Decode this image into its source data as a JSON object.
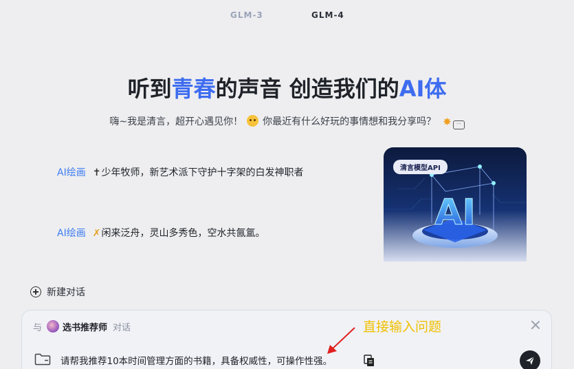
{
  "model_tabs": [
    {
      "label": "GLM-3",
      "active": false
    },
    {
      "label": "GLM-4",
      "active": true
    }
  ],
  "hero": {
    "title_part1": "听到",
    "title_accent1": "青春",
    "title_part2": "的声音 创造我们的",
    "title_accent2": "AI体",
    "subtitle_part1": "嗨~我是清言，超开心遇见你！",
    "subtitle_part2": "你最近有什么好玩的事情想和我分享吗？"
  },
  "suggestions": [
    {
      "tag": "AI绘画",
      "icon": "✝",
      "text": "少年牧师，新艺术派下守护十字架的白发神职者"
    },
    {
      "tag": "AI绘画",
      "icon": "✗",
      "text": "闲来泛舟，灵山多秀色，空水共氤氲。"
    }
  ],
  "ai_card": {
    "badge": "清言模型API",
    "big_text": "AI"
  },
  "new_chat": {
    "label": "新建对话"
  },
  "input_panel": {
    "with_label": "与",
    "agent_name": "选书推荐师",
    "chat_label": "对话",
    "query_value": "请帮我推荐10本时间管理方面的书籍，具备权威性，可操作性强。"
  },
  "annotation": {
    "text": "直接输入问题"
  },
  "colors": {
    "accent": "#3d6cf0",
    "annotation": "#f0c000",
    "background": "#eeeef0"
  }
}
